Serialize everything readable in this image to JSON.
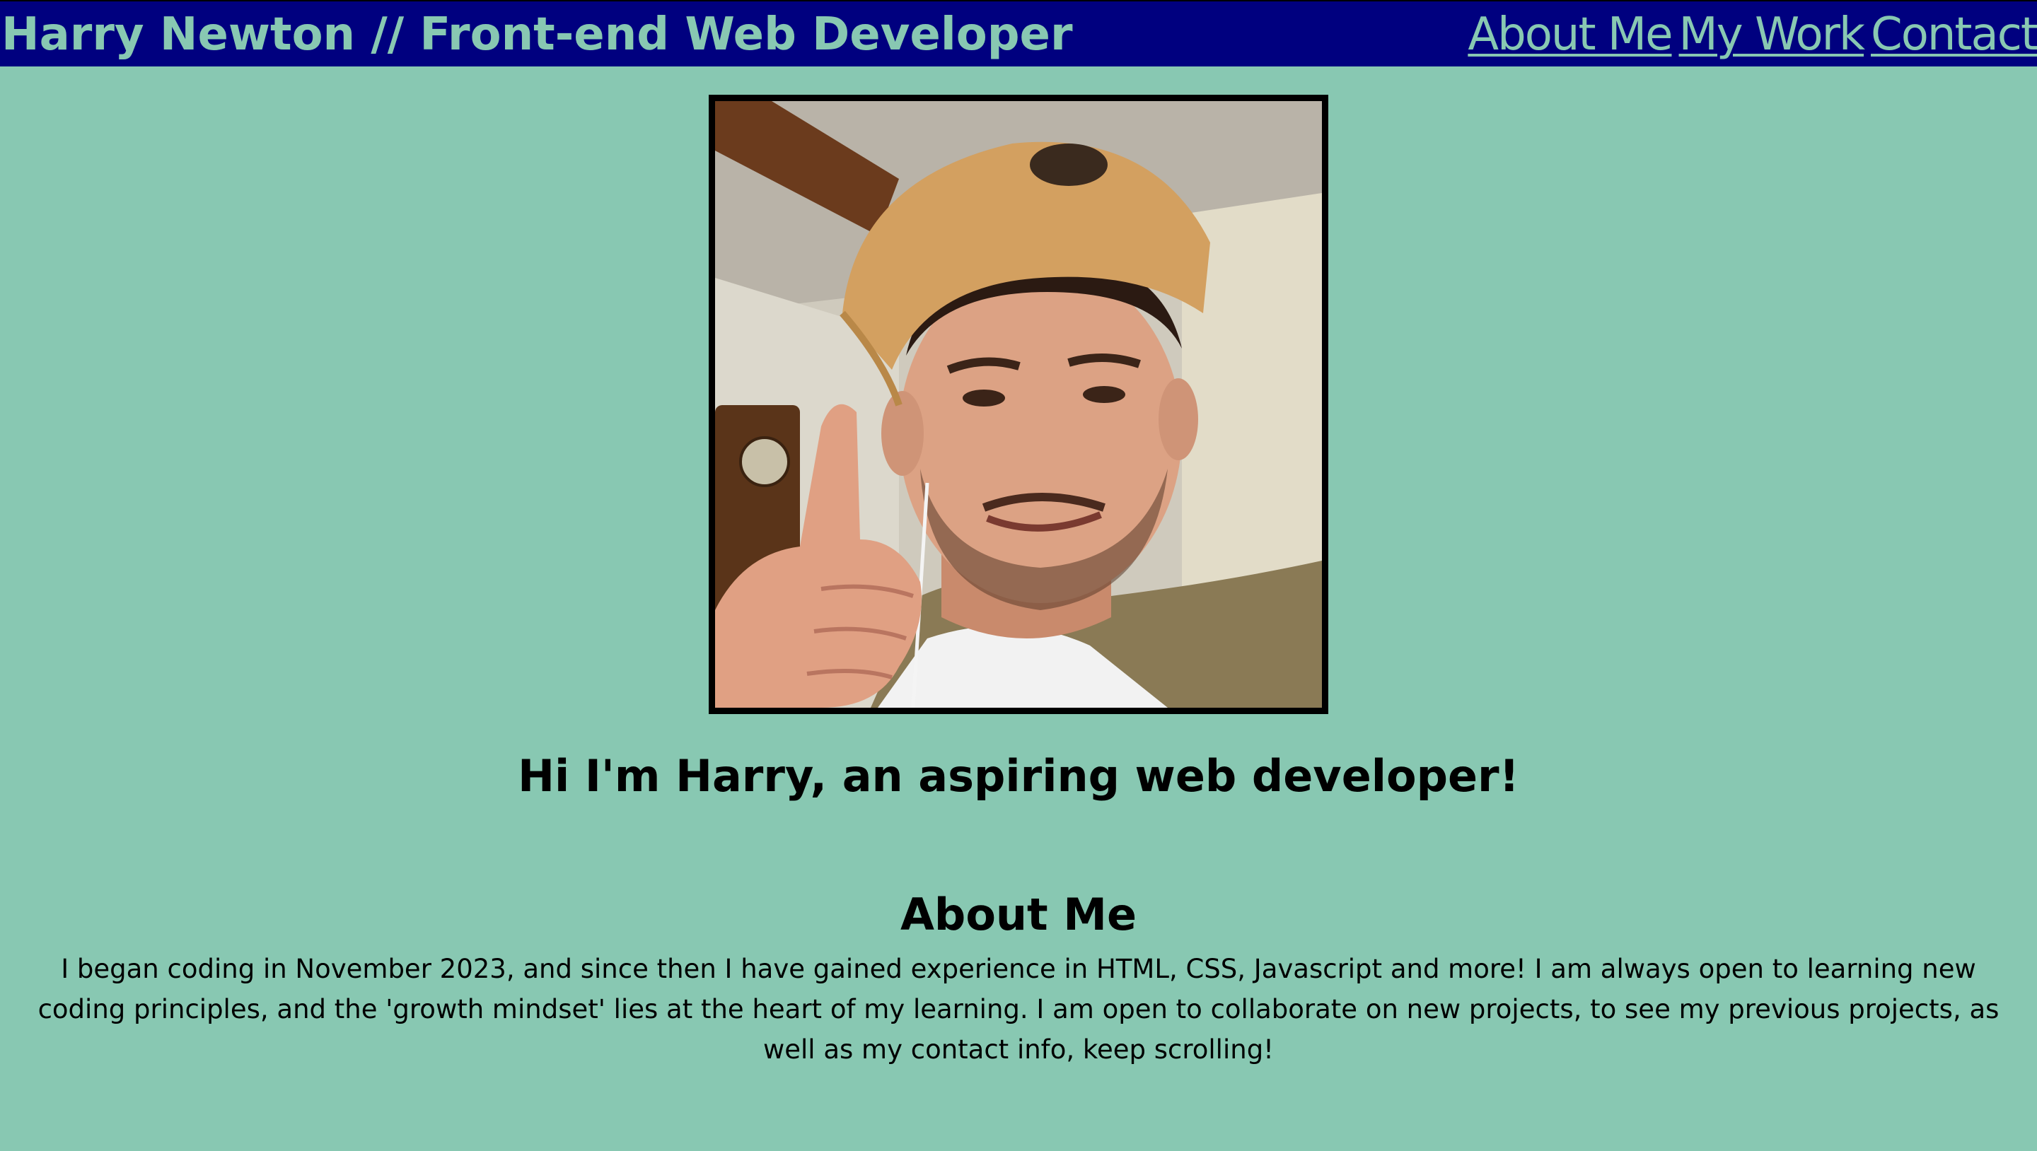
{
  "header": {
    "title": "Harry Newton // Front-end Web Developer",
    "nav": [
      "About Me",
      "My Work",
      "Contact"
    ]
  },
  "hero": {
    "heading": "Hi I'm Harry, an aspiring web developer!"
  },
  "about": {
    "heading": "About Me",
    "text": "I began coding in November 2023, and since then I have gained experience in HTML, CSS, Javascript and more! I am always open to learning new coding principles, and the 'growth mindset' lies at the heart of my learning. I am open to collaborate on new projects, to see my previous projects, as well as my contact info, keep scrolling!"
  },
  "colors": {
    "background": "#88c8b2",
    "header_background": "#00007f",
    "header_text": "#88c8b2"
  }
}
